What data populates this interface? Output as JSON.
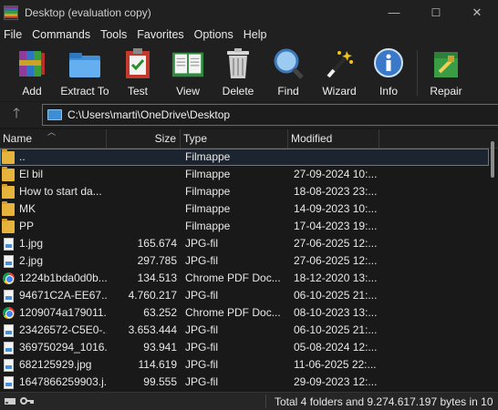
{
  "window": {
    "title": "Desktop (evaluation copy)",
    "controls": {
      "minimize": "—",
      "maximize": "☐",
      "close": "✕"
    }
  },
  "menu": [
    "File",
    "Commands",
    "Tools",
    "Favorites",
    "Options",
    "Help"
  ],
  "toolbar": {
    "buttons": [
      {
        "label": "Add",
        "icon": "archive-add-icon"
      },
      {
        "label": "Extract To",
        "icon": "extract-folder-icon"
      },
      {
        "label": "Test",
        "icon": "test-clipboard-icon"
      },
      {
        "label": "View",
        "icon": "view-book-icon"
      },
      {
        "label": "Delete",
        "icon": "trash-icon"
      },
      {
        "label": "Find",
        "icon": "magnifier-icon"
      },
      {
        "label": "Wizard",
        "icon": "wand-icon"
      },
      {
        "label": "Info",
        "icon": "info-icon"
      },
      {
        "label": "Repair",
        "icon": "repair-kit-icon"
      }
    ]
  },
  "address": {
    "up_arrow": "🡑",
    "path": "C:\\Users\\marti\\OneDrive\\Desktop"
  },
  "columns": {
    "name": "Name",
    "size": "Size",
    "type": "Type",
    "modified": "Modified",
    "sort_indicator": "︿"
  },
  "files": [
    {
      "name": "..",
      "size": "",
      "type": "Filmappe",
      "modified": "",
      "icon": "folder",
      "selected": true
    },
    {
      "name": "El bil",
      "size": "",
      "type": "Filmappe",
      "modified": "27-09-2024 10:...",
      "icon": "folder"
    },
    {
      "name": "How to start da...",
      "size": "",
      "type": "Filmappe",
      "modified": "18-08-2023 23:...",
      "icon": "folder"
    },
    {
      "name": "MK",
      "size": "",
      "type": "Filmappe",
      "modified": "14-09-2023 10:...",
      "icon": "folder"
    },
    {
      "name": "PP",
      "size": "",
      "type": "Filmappe",
      "modified": "17-04-2023 19:...",
      "icon": "folder"
    },
    {
      "name": "1.jpg",
      "size": "165.674",
      "type": "JPG-fil",
      "modified": "27-06-2025 12:...",
      "icon": "jpg"
    },
    {
      "name": "2.jpg",
      "size": "297.785",
      "type": "JPG-fil",
      "modified": "27-06-2025 12:...",
      "icon": "jpg"
    },
    {
      "name": "1224b1bda0d0b...",
      "size": "134.513",
      "type": "Chrome PDF Doc...",
      "modified": "18-12-2020 13:...",
      "icon": "pdf"
    },
    {
      "name": "94671C2A-EE67...",
      "size": "4.760.217",
      "type": "JPG-fil",
      "modified": "06-10-2025 21:...",
      "icon": "jpg"
    },
    {
      "name": "1209074a179011...",
      "size": "63.252",
      "type": "Chrome PDF Doc...",
      "modified": "08-10-2023 13:...",
      "icon": "pdf"
    },
    {
      "name": "23426572-C5E0-...",
      "size": "3.653.444",
      "type": "JPG-fil",
      "modified": "06-10-2025 21:...",
      "icon": "jpg"
    },
    {
      "name": "369750294_1016...",
      "size": "93.941",
      "type": "JPG-fil",
      "modified": "05-08-2024 12:...",
      "icon": "jpg"
    },
    {
      "name": "682125929.jpg",
      "size": "114.619",
      "type": "JPG-fil",
      "modified": "11-06-2025 22:...",
      "icon": "jpg"
    },
    {
      "name": "1647866259903.j...",
      "size": "99.555",
      "type": "JPG-fil",
      "modified": "29-09-2023 12:...",
      "icon": "jpg"
    }
  ],
  "status": {
    "text": "Total 4 folders and 9.274.617.197 bytes in 10"
  },
  "colors": {
    "background": "#191919",
    "chrome": "#202020",
    "folder": "#e6b33c",
    "selection_border": "#4a7fa8"
  }
}
